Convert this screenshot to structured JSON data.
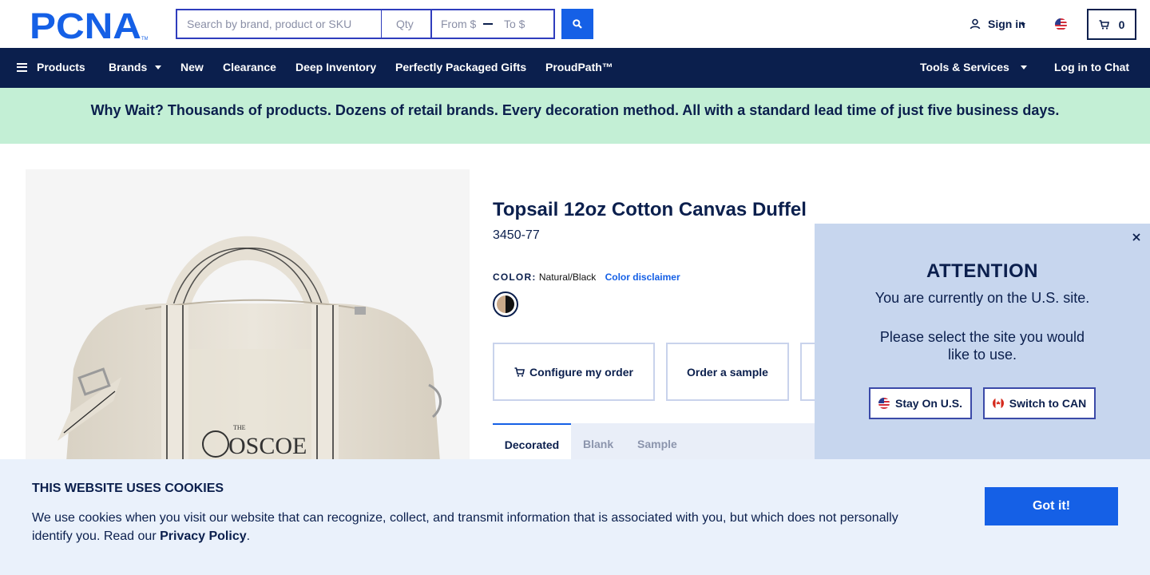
{
  "brand": {
    "logo_text": "PCNA",
    "accent": "#1560e6",
    "navy": "#0b1f4d"
  },
  "search": {
    "placeholder": "Search by brand, product or SKU",
    "qty_placeholder": "Qty",
    "from_placeholder": "From $",
    "to_placeholder": "To $",
    "search_icon": "search-icon"
  },
  "account": {
    "signin_label": "Sign in",
    "cart_count": "0"
  },
  "nav": {
    "products": "Products",
    "brands": "Brands",
    "new": "New",
    "clearance": "Clearance",
    "deep_inventory": "Deep Inventory",
    "gifts": "Perfectly Packaged Gifts",
    "proudpath": "ProudPath™",
    "tools": "Tools & Services",
    "chat": "Log in to Chat"
  },
  "promo": {
    "text": "Why Wait? Thousands of products. Dozens of retail brands. Every decoration method. All with a standard lead time of just five business days."
  },
  "product": {
    "title": "Topsail 12oz Cotton Canvas Duffel",
    "sku": "3450-77",
    "color_label": "COLOR:",
    "color_value": "Natural/Black",
    "color_disclaimer": "Color disclaimer",
    "image_print_line1": "THE",
    "image_print_line2": "OSCOE",
    "actions": {
      "configure": "Configure my order",
      "sample": "Order a sample"
    },
    "tabs": [
      "Decorated",
      "Blank",
      "Sample"
    ]
  },
  "site_popup": {
    "title": "ATTENTION",
    "message": "You are currently on the U.S. site.",
    "message2": "Please select the site you would like to use.",
    "stay_label": "Stay On U.S.",
    "switch_label": "Switch to CAN"
  },
  "cookie": {
    "title": "THIS WEBSITE USES COOKIES",
    "text": "We use cookies when you visit our website that can recognize, collect, and transmit information that is associated with you, but which does not personally identify you. Read our ",
    "link": "Privacy Policy",
    "end": ".",
    "button": "Got it!"
  }
}
